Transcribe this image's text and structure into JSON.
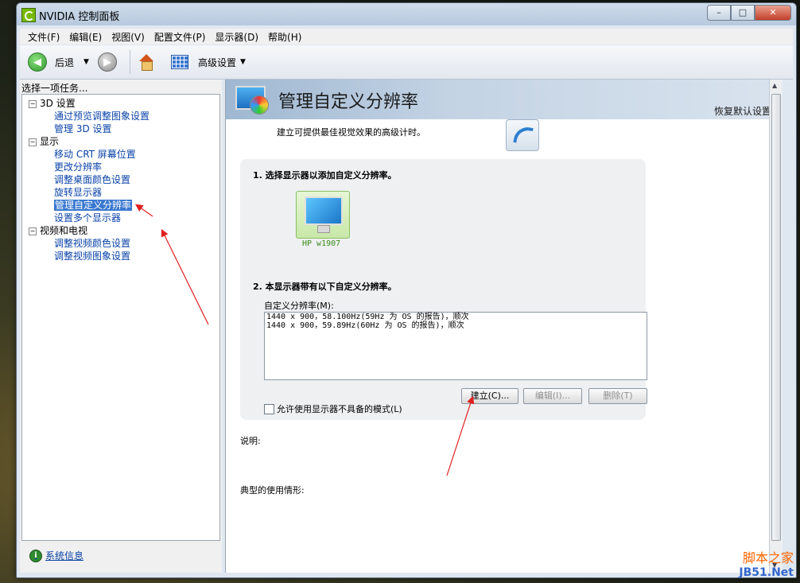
{
  "window": {
    "title": "NVIDIA 控制面板"
  },
  "menu": [
    "文件(F)",
    "编辑(E)",
    "视图(V)",
    "配置文件(P)",
    "显示器(D)",
    "帮助(H)"
  ],
  "toolbar": {
    "back_label": "后退",
    "advanced_label": "高级设置"
  },
  "left": {
    "header": "选择一项任务...",
    "tree": [
      {
        "label": "3D 设置",
        "kind": "cat"
      },
      {
        "label": "通过预览调整图象设置",
        "kind": "link"
      },
      {
        "label": "管理 3D 设置",
        "kind": "link"
      },
      {
        "label": "显示",
        "kind": "cat"
      },
      {
        "label": "移动 CRT 屏幕位置",
        "kind": "link"
      },
      {
        "label": "更改分辨率",
        "kind": "link"
      },
      {
        "label": "调整桌面颜色设置",
        "kind": "link"
      },
      {
        "label": "旋转显示器",
        "kind": "link"
      },
      {
        "label": "管理自定义分辨率",
        "kind": "link",
        "selected": true
      },
      {
        "label": "设置多个显示器",
        "kind": "link"
      },
      {
        "label": "视频和电视",
        "kind": "cat"
      },
      {
        "label": "调整视频颜色设置",
        "kind": "link"
      },
      {
        "label": "调整视频图象设置",
        "kind": "link"
      }
    ],
    "system_info": "系统信息"
  },
  "right": {
    "title": "管理自定义分辨率",
    "restore_defaults": "恢复默认设置",
    "intro": "建立可提供最佳视觉效果的高级计时。",
    "step1": "1. 选择显示器以添加自定义分辨率。",
    "display_name": "HP w1907",
    "step2": "2. 本显示器带有以下自定义分辨率。",
    "list_label": "自定义分辨率(M):",
    "resolutions": [
      "1440 x 900，58.100Hz(59Hz 为 OS 的报告)，顺次",
      "1440 x 900，59.89Hz(60Hz 为 OS 的报告)，顺次"
    ],
    "buttons": {
      "create": "建立(C)...",
      "edit": "编辑(I)...",
      "delete": "删除(T)"
    },
    "checkbox_label": "允许使用显示器不具备的模式(L)",
    "description_label": "说明:",
    "usage_label": "典型的使用情形:"
  },
  "watermark": {
    "line1": "脚本之家",
    "line2": "JB51.Net"
  },
  "colors": {
    "accent": "#3a78d0",
    "link": "#0a43a8",
    "annotation_arrow": "#e02020"
  },
  "icons": [
    "nvidia-icon",
    "back-icon",
    "forward-icon",
    "home-icon",
    "grid-icon",
    "monitor-icon",
    "system-info-icon"
  ]
}
